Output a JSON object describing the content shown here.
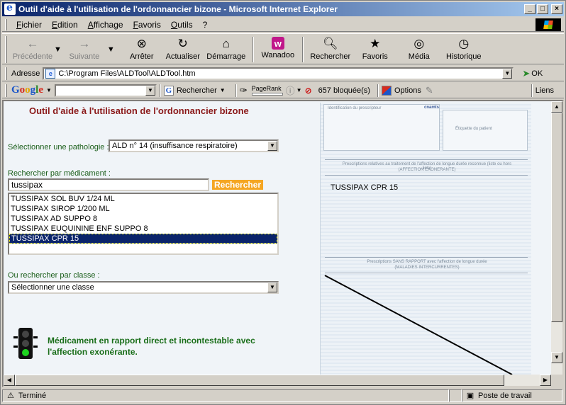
{
  "window": {
    "title": "Outil d'aide à l'utilisation de l'ordonnancier bizone - Microsoft Internet Explorer",
    "controls": {
      "minimize": "_",
      "maximize": "□",
      "close": "×"
    }
  },
  "menu": [
    "Fichier",
    "Edition",
    "Affichage",
    "Favoris",
    "Outils",
    "?"
  ],
  "toolbar": {
    "back": "Précédente",
    "forward": "Suivante",
    "stop": "Arrêter",
    "refresh": "Actualiser",
    "home": "Démarrage",
    "wanadoo": "Wanadoo",
    "search": "Rechercher",
    "favorites": "Favoris",
    "media": "Média",
    "history": "Historique"
  },
  "address": {
    "label": "Adresse",
    "url": "C:\\Program Files\\ALDTool\\ALDTool.htm",
    "go": "OK"
  },
  "google_bar": {
    "logo": "Google",
    "search_value": "",
    "search_button": "Rechercher",
    "pagerank_label": "PageRank",
    "popups_blocked": "657 bloquée(s)",
    "options": "Options",
    "links": "Liens"
  },
  "page": {
    "title": "Outil d'aide à l'utilisation de l'ordonnancier bizone",
    "pathology_label": "Sélectionner une pathologie :",
    "pathology_value": "ALD n° 14 (insuffisance respiratoire)",
    "search_label": "Rechercher par médicament :",
    "search_value": "tussipax",
    "search_button": "Rechercher",
    "results": [
      "TUSSIPAX SOL BUV 1/24 ML",
      "TUSSIPAX SIROP 1/200 ML",
      "TUSSIPAX AD SUPPO  8",
      "TUSSIPAX EUQUININE ENF SUPPO  8",
      "TUSSIPAX CPR 15"
    ],
    "selected_index": 4,
    "class_label": "Ou rechercher par classe :",
    "class_value": "Sélectionner une classe",
    "legend_text": "Médicament en rapport direct et incontestable avec l'affection exonérante.",
    "form": {
      "prescriber_id": "Identification du prescripteur",
      "logo": "cnamts",
      "patient_label": "Étiquette du patient",
      "section1": "Prescriptions relatives au traitement de l'affection de longue durée reconnue (liste ou hors liste)",
      "section1_sub": "(AFFECTION EXONERANTE)",
      "drug": "TUSSIPAX CPR 15",
      "section2": "Prescriptions SANS RAPPORT avec l'affection de longue durée",
      "section2_sub": "(MALADIES INTERCURRENTES)"
    }
  },
  "status": {
    "text": "Terminé",
    "zone": "Poste de travail"
  },
  "colors": {
    "title_red": "#8b1a1a",
    "label_green": "#1a5e1a",
    "button_orange": "#f5a623",
    "selection": "#0a246a"
  }
}
